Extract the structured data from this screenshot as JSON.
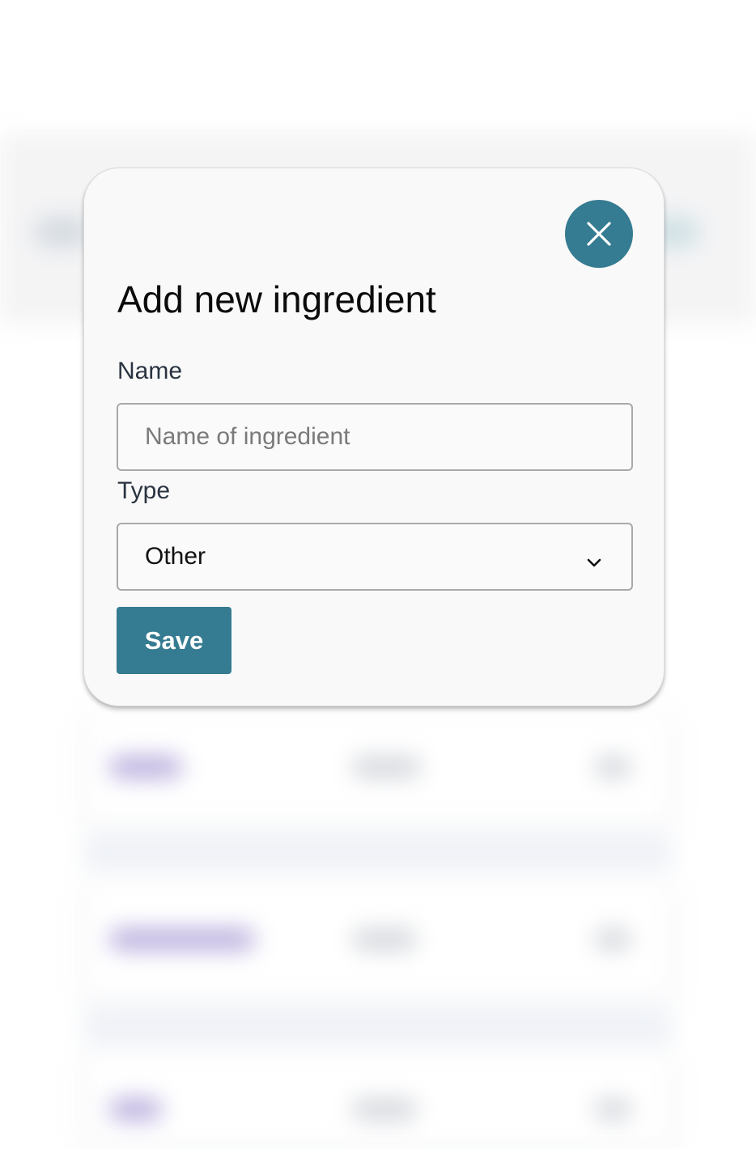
{
  "modal": {
    "title": "Add new ingredient",
    "close_icon": "close-icon",
    "fields": {
      "name": {
        "label": "Name",
        "value": "",
        "placeholder": "Name of ingredient"
      },
      "type": {
        "label": "Type",
        "selected": "Other",
        "icon": "chevron-down-icon"
      }
    },
    "save_label": "Save"
  },
  "colors": {
    "accent": "#357b91",
    "modal_background": "#f9f9f9",
    "input_border": "#a9a9a9",
    "label_text": "#2a3441"
  }
}
